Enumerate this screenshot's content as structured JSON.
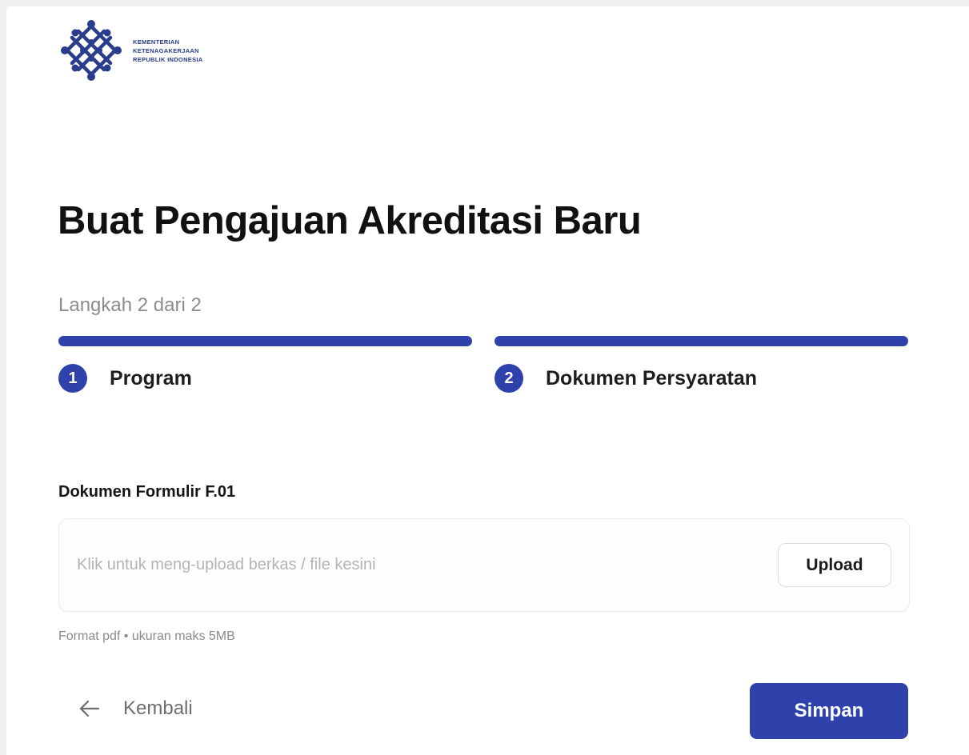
{
  "logo": {
    "lines": [
      "KEMENTERIAN",
      "KETENAGAKERJAAN",
      "REPUBLIK INDONESIA"
    ],
    "icon": "ministry-emblem-icon",
    "color": "#2a3c8c"
  },
  "page_title": "Buat Pengajuan Akreditasi Baru",
  "step_counter": "Langkah 2 dari 2",
  "progress": {
    "current_step": 2,
    "total_steps": 2
  },
  "steps": [
    {
      "number": "1",
      "label": "Program"
    },
    {
      "number": "2",
      "label": "Dokumen Persyaratan"
    }
  ],
  "upload_field": {
    "label": "Dokumen Formulir F.01",
    "placeholder": "Klik untuk meng-upload berkas / file kesini",
    "button_label": "Upload",
    "hint": "Format pdf • ukuran maks 5MB"
  },
  "footer": {
    "back_label": "Kembali",
    "back_icon": "arrow-left-icon",
    "save_label": "Simpan"
  },
  "colors": {
    "primary": "#2f41aa",
    "title": "#111111",
    "muted": "#8c8c8c"
  }
}
